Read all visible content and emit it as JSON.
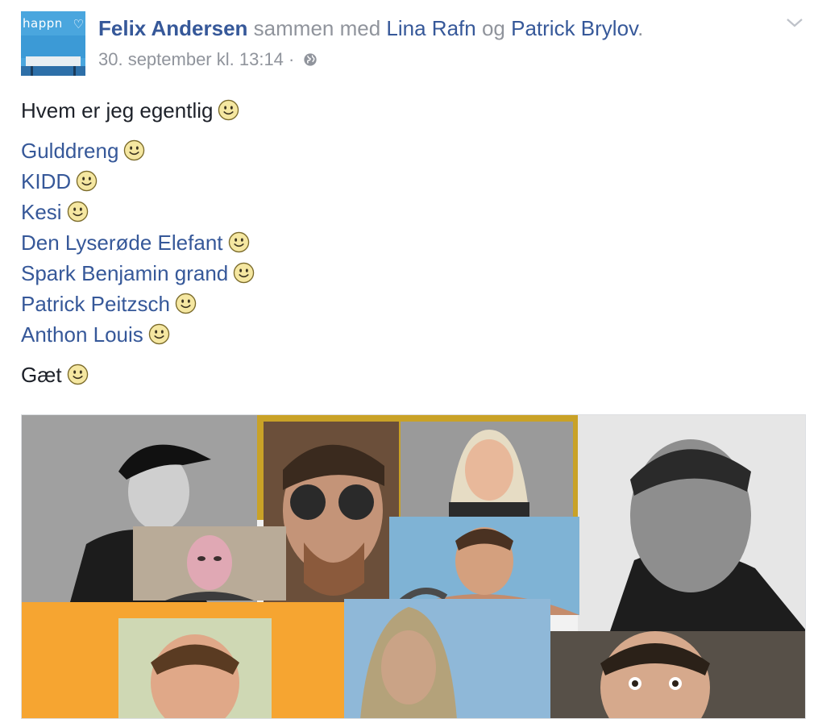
{
  "post": {
    "avatar_logo": "happn",
    "author": "Felix Andersen",
    "with_word": "sammen med",
    "tagged_1": "Lina Rafn",
    "and_word": "og",
    "tagged_2": "Patrick Brylov",
    "period": ".",
    "timestamp": "30. september kl. 13:14",
    "separator": "·",
    "privacy_icon": "globe-icon",
    "menu_icon": "chevron-down-icon",
    "intro": "Hvem er jeg egentlig",
    "names": [
      "Gulddreng",
      "KIDD",
      "Kesi",
      "Den Lyserøde Elefant",
      "Spark Benjamin grand",
      "Patrick Peitzsch",
      "Anthon Louis"
    ],
    "outro": "Gæt",
    "emoji_icon": "smiley-emoji-icon"
  },
  "colors": {
    "link": "#365899",
    "muted": "#90949c",
    "text": "#1d2129",
    "avatar_bg": "#4aa6de",
    "gold_frame": "#c9a227",
    "orange_bg": "#f6a531"
  }
}
